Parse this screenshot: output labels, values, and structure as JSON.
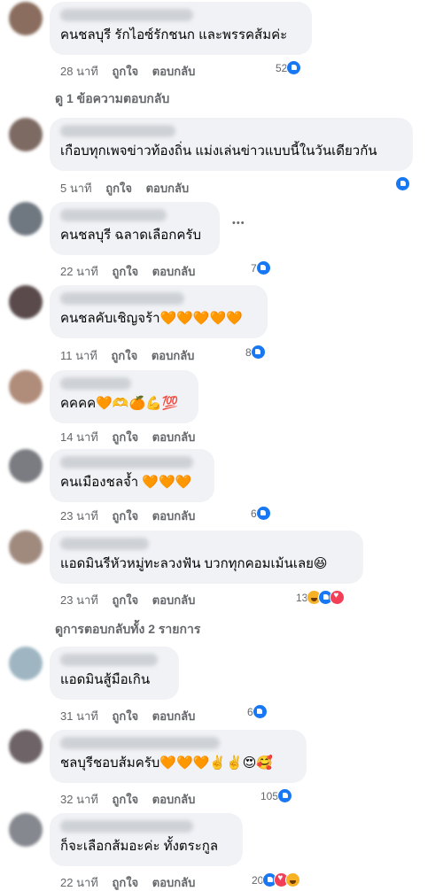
{
  "comments": [
    {
      "text": "คนชลบุรี รักไอซ์รักชนก และพรรคส้มค่ะ",
      "time": "28 นาที",
      "like": "ถูกใจ",
      "reply": "ตอบกลับ",
      "reactions": "52",
      "reaction_icons": [
        "like-icon"
      ],
      "avatar_color": "#8a6d5e"
    },
    {
      "text": "เกือบทุกเพจข่าวท้องถิ่น แม่งเล่นข่าวแบบนี้ในวันเดียวกัน",
      "time": "5 นาที",
      "like": "ถูกใจ",
      "reply": "ตอบกลับ",
      "reactions": "",
      "reaction_icons": [
        "like-icon"
      ],
      "avatar_color": "#7d6a62"
    },
    {
      "text": "คนชลบุรี ฉลาดเลือกครับ",
      "time": "22 นาที",
      "like": "ถูกใจ",
      "reply": "ตอบกลับ",
      "reactions": "7",
      "reaction_icons": [
        "like-icon"
      ],
      "avatar_color": "#6f7780"
    },
    {
      "text": "คนชลคับเชิญจร้า🧡🧡🧡🧡🧡",
      "time": "11 นาที",
      "like": "ถูกใจ",
      "reply": "ตอบกลับ",
      "reactions": "8",
      "reaction_icons": [
        "like-icon"
      ],
      "avatar_color": "#5a4a4c"
    },
    {
      "text": "คคคค🧡🫶🍊💪💯",
      "time": "14 นาที",
      "like": "ถูกใจ",
      "reply": "ตอบกลับ",
      "reactions": "",
      "reaction_icons": [],
      "avatar_color": "#b08c7a"
    },
    {
      "text": "คนเมืองชลจ้ำ 🧡🧡🧡",
      "time": "23 นาที",
      "like": "ถูกใจ",
      "reply": "ตอบกลับ",
      "reactions": "6",
      "reaction_icons": [
        "like-icon"
      ],
      "avatar_color": "#7a7c82"
    },
    {
      "text": "แอดมินรีหัวหมู่ทะลวงฟัน บวกทุกคอมเม้นเลย😆",
      "time": "23 นาที",
      "like": "ถูกใจ",
      "reply": "ตอบกลับ",
      "reactions": "13",
      "reaction_icons": [
        "haha-icon",
        "like-icon",
        "love-icon"
      ],
      "avatar_color": "#a08a7e"
    },
    {
      "text": "แอดมินสู้มือเกิน",
      "time": "31 นาที",
      "like": "ถูกใจ",
      "reply": "ตอบกลับ",
      "reactions": "6",
      "reaction_icons": [
        "like-icon"
      ],
      "avatar_color": "#9fb6c2"
    },
    {
      "text": "ชลบุรีชอบส้มครับ🧡🧡🧡✌️✌️😍🥰",
      "time": "32 นาที",
      "like": "ถูกใจ",
      "reply": "ตอบกลับ",
      "reactions": "105",
      "reaction_icons": [
        "like-icon"
      ],
      "avatar_color": "#6e6468"
    },
    {
      "text": "ก็จะเลือกส้มอะค่ะ ทั้งตระกูล",
      "time": "22 นาที",
      "like": "ถูกใจ",
      "reply": "ตอบกลับ",
      "reactions": "20",
      "reaction_icons": [
        "like-icon",
        "love-icon",
        "haha-icon"
      ],
      "avatar_color": "#85888f"
    }
  ],
  "view_replies_1": "ดู 1 ข้อความตอบกลับ",
  "view_replies_2": "ดูการตอบกลับทั้ง 2 รายการ",
  "more_icon": "•••"
}
